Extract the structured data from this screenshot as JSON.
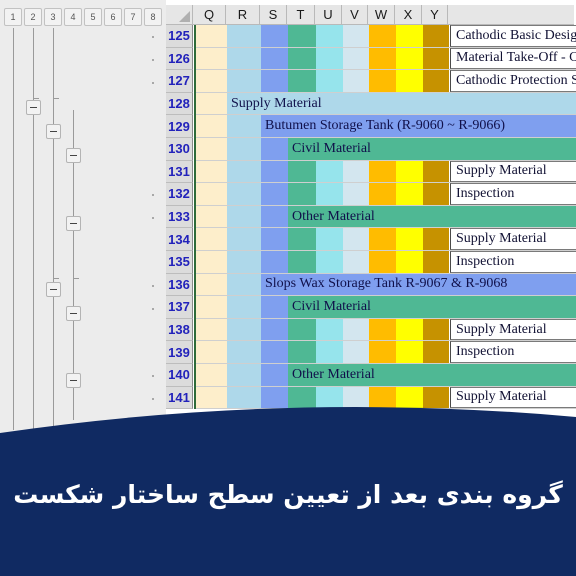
{
  "app": {
    "type": "spreadsheet",
    "colors": {
      "banner_navy": "#102a62",
      "row_header_text": "#2222bb",
      "band_cream": "#fdeecb",
      "band_lightblue": "#aed8ea",
      "band_cornflower": "#7f9fef",
      "band_teal": "#4fb894",
      "band_cyan": "#96e4ec",
      "band_paleblue": "#d3e6ef",
      "band_orange": "#ffbc00",
      "band_yellow": "#ffff00",
      "band_gold": "#c69200",
      "grid_line": "#cfcfcf",
      "green_divider": "#2f6b3a"
    }
  },
  "outline": {
    "level_buttons": [
      "1",
      "2",
      "3",
      "4",
      "5",
      "6",
      "7",
      "8"
    ],
    "collapse_symbol": "−"
  },
  "sheet": {
    "column_headers": [
      "Q",
      "R",
      "S",
      "T",
      "U",
      "V",
      "W",
      "X",
      "Y"
    ],
    "row_numbers": [
      "125",
      "126",
      "127",
      "128",
      "129",
      "130",
      "131",
      "132",
      "133",
      "134",
      "135",
      "136",
      "137",
      "138",
      "139",
      "140",
      "141"
    ],
    "rows": [
      {
        "num": "125",
        "kind": "bands_text",
        "text": "Cathodic Basic Design &"
      },
      {
        "num": "126",
        "kind": "bands_text",
        "text": "Material Take-Off - Cath"
      },
      {
        "num": "127",
        "kind": "bands_text",
        "text": "Cathodic Protection Syst"
      },
      {
        "num": "128",
        "kind": "group1",
        "text": "Supply Material"
      },
      {
        "num": "129",
        "kind": "group2",
        "text": "Butumen Storage Tank (R-9060 ~ R-9066)"
      },
      {
        "num": "130",
        "kind": "group3",
        "text": "Civil Material"
      },
      {
        "num": "131",
        "kind": "leaf",
        "text": "Supply Material"
      },
      {
        "num": "132",
        "kind": "leaf",
        "text": "Inspection"
      },
      {
        "num": "133",
        "kind": "group3",
        "text": "Other Material"
      },
      {
        "num": "134",
        "kind": "leaf",
        "text": "Supply Material"
      },
      {
        "num": "135",
        "kind": "leaf",
        "text": "Inspection"
      },
      {
        "num": "136",
        "kind": "group2",
        "text": "Slops Wax Storage Tank R-9067 & R-9068"
      },
      {
        "num": "137",
        "kind": "group3",
        "text": "Civil Material"
      },
      {
        "num": "138",
        "kind": "leaf",
        "text": "Supply Material"
      },
      {
        "num": "139",
        "kind": "leaf",
        "text": "Inspection"
      },
      {
        "num": "140",
        "kind": "group3",
        "text": "Other Material"
      },
      {
        "num": "141",
        "kind": "leaf",
        "text": "Supply Material"
      }
    ]
  },
  "banner": {
    "caption": "گروه بندی بعد از تعیین سطح ساختار شکست"
  }
}
